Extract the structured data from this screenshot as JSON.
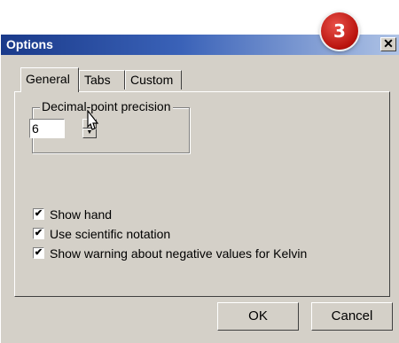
{
  "window": {
    "title": "Options",
    "close_glyph": "✕"
  },
  "step_badge": "3",
  "tabs": [
    {
      "label": "General",
      "active": true
    },
    {
      "label": "Tabs",
      "active": false
    },
    {
      "label": "Custom",
      "active": false
    }
  ],
  "precision": {
    "group_label": "Decimal-point precision",
    "value": "6",
    "up_glyph": "▲",
    "down_glyph": "▼"
  },
  "checkboxes": [
    {
      "label": "Show hand",
      "checked": true,
      "mark": "✔"
    },
    {
      "label": "Use scientific notation",
      "checked": true,
      "mark": "✔"
    },
    {
      "label": "Show warning about negative values for Kelvin",
      "checked": true,
      "mark": "✔"
    }
  ],
  "buttons": {
    "ok": "OK",
    "cancel": "Cancel"
  },
  "icons": {
    "cursor": "pointer-cursor-icon"
  }
}
